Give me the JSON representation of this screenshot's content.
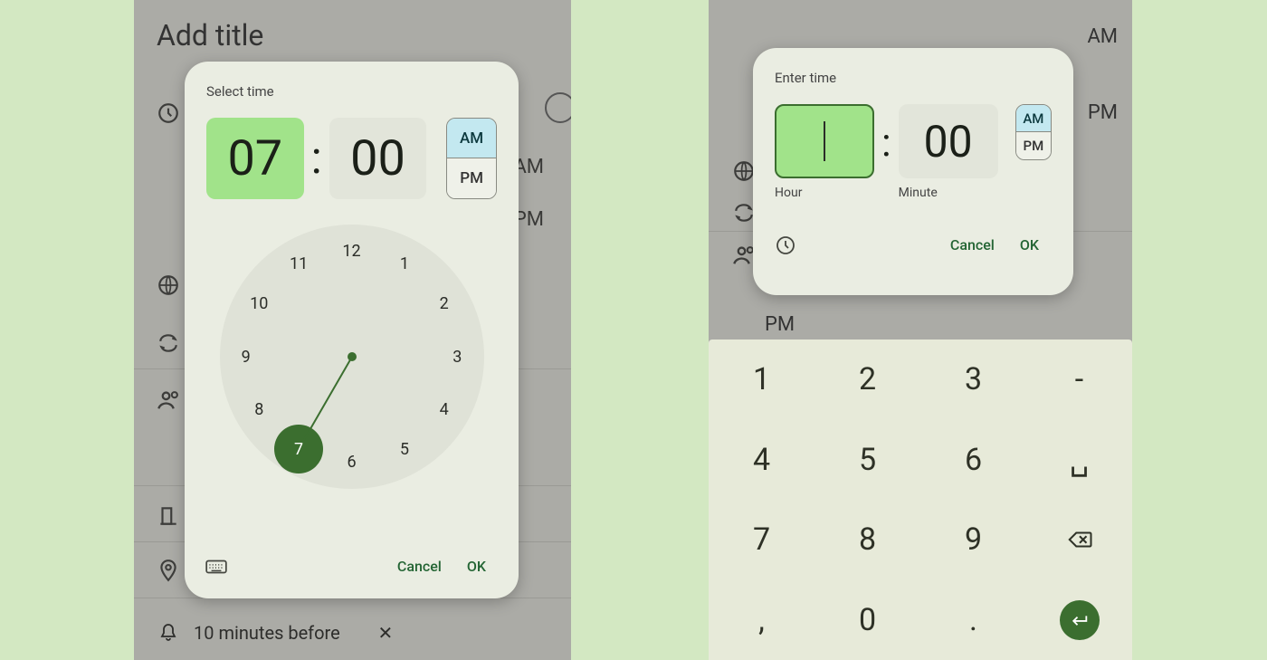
{
  "background": {
    "add_title": "Add title",
    "am": "AM",
    "pm": "PM",
    "notification": "10 minutes before"
  },
  "dialog_clock": {
    "title": "Select time",
    "hour": "07",
    "minute": "00",
    "am": "AM",
    "pm": "PM",
    "selected_hour_on_face": "7",
    "cancel": "Cancel",
    "ok": "OK",
    "clock_numbers": [
      "12",
      "1",
      "2",
      "3",
      "4",
      "5",
      "6",
      "7",
      "8",
      "9",
      "10",
      "11"
    ]
  },
  "dialog_input": {
    "title": "Enter time",
    "hour_value": "",
    "minute_value": "00",
    "hour_label": "Hour",
    "minute_label": "Minute",
    "am": "AM",
    "pm": "PM",
    "cancel": "Cancel",
    "ok": "OK"
  },
  "keypad": {
    "r1": [
      "1",
      "2",
      "3",
      "-"
    ],
    "r2": [
      "4",
      "5",
      "6"
    ],
    "r3": [
      "7",
      "8",
      "9"
    ],
    "r4": [
      ",",
      "0",
      "."
    ]
  }
}
